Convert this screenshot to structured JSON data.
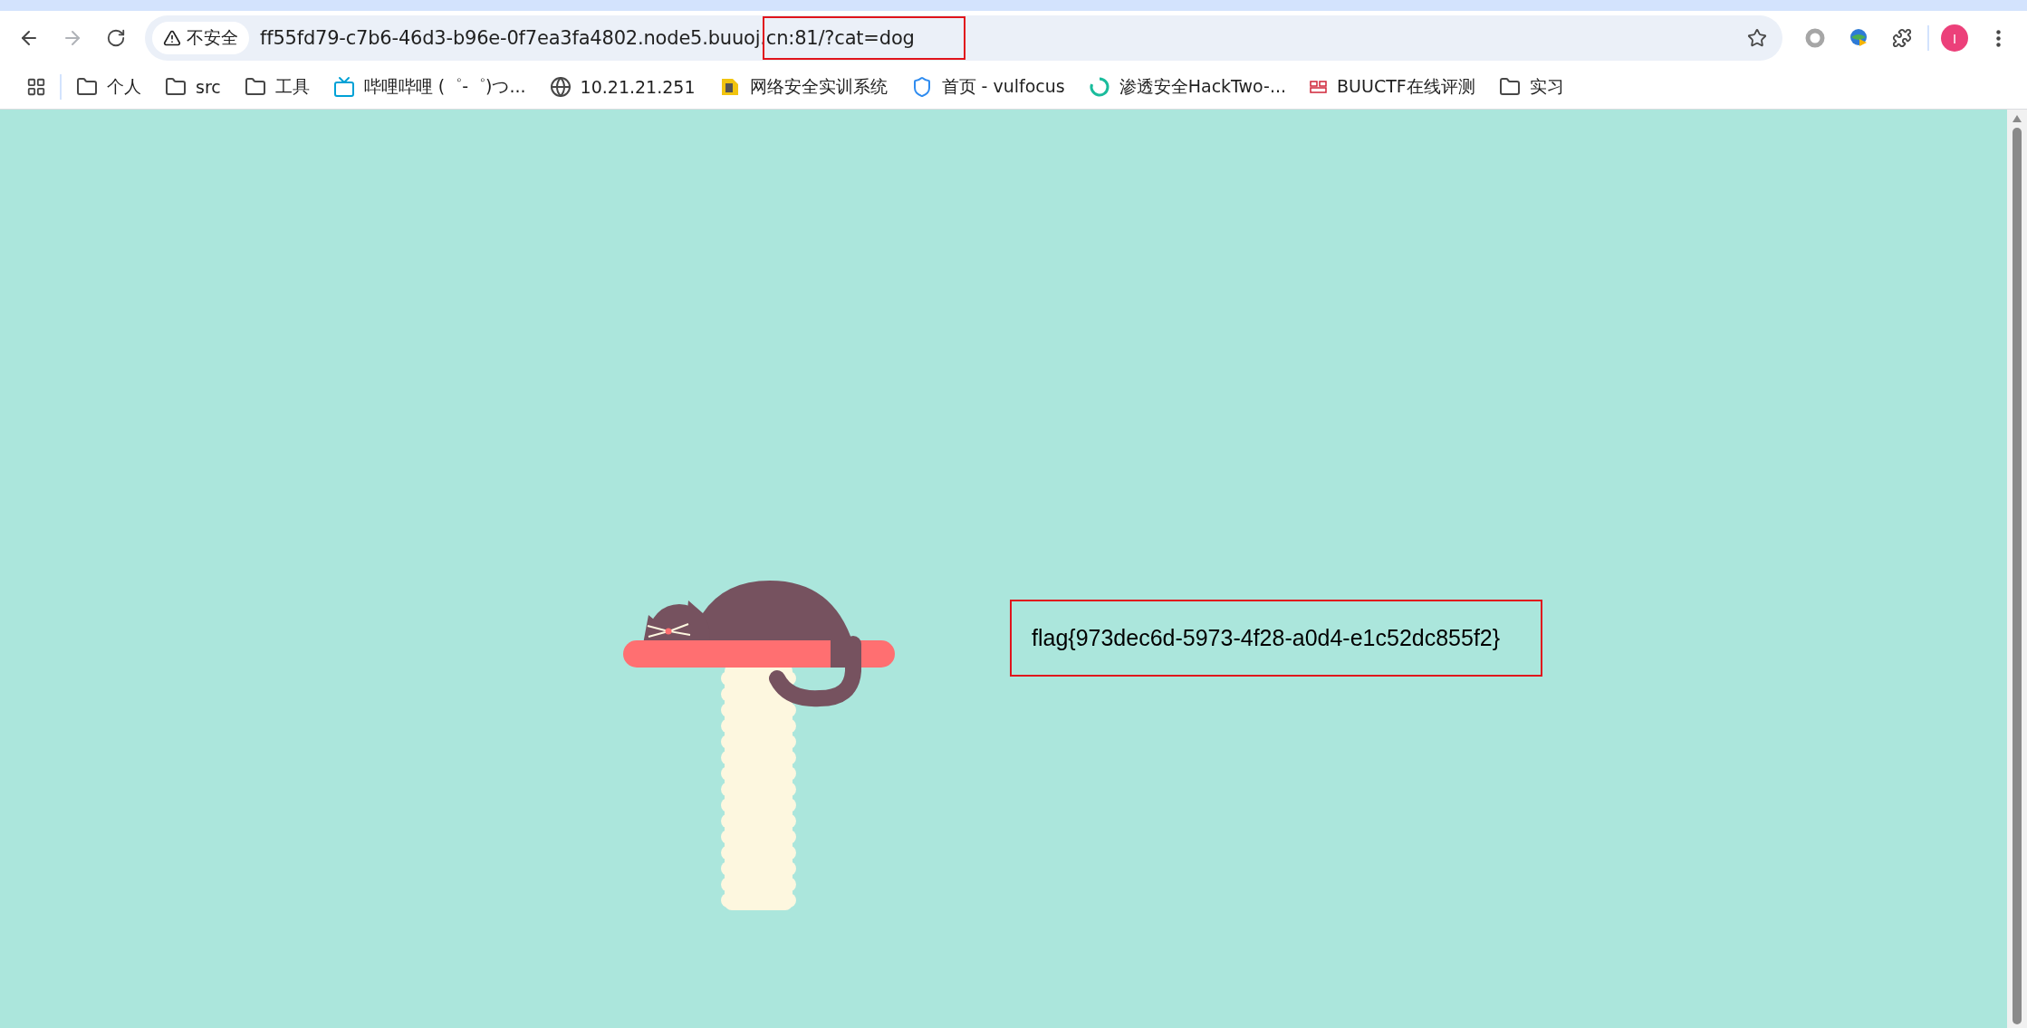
{
  "toolbar": {
    "back": {
      "disabled": false
    },
    "forward": {
      "disabled": true
    },
    "security_chip": "不安全",
    "url": "ff55fd79-c7b6-46d3-b96e-0f7ea3fa4802.node5.buuoj.cn:81/?cat=dog",
    "avatar": "I"
  },
  "bookmarks": [
    {
      "kind": "folder",
      "label": "个人"
    },
    {
      "kind": "folder",
      "label": "src"
    },
    {
      "kind": "folder",
      "label": "工具"
    },
    {
      "kind": "tv",
      "label": "哔哩哔哩 (゜-゜)つ..."
    },
    {
      "kind": "globe",
      "label": "10.21.21.251"
    },
    {
      "kind": "badge",
      "label": "网络安全实训系统"
    },
    {
      "kind": "shield",
      "label": "首页 - vulfocus"
    },
    {
      "kind": "ring",
      "label": "渗透安全HackTwo-..."
    },
    {
      "kind": "logo",
      "label": "BUUCTF在线评测"
    },
    {
      "kind": "folder",
      "label": "实习"
    }
  ],
  "page": {
    "flag": "flag{973dec6d-5973-4f28-a0d4-e1c52dc855f2}"
  }
}
